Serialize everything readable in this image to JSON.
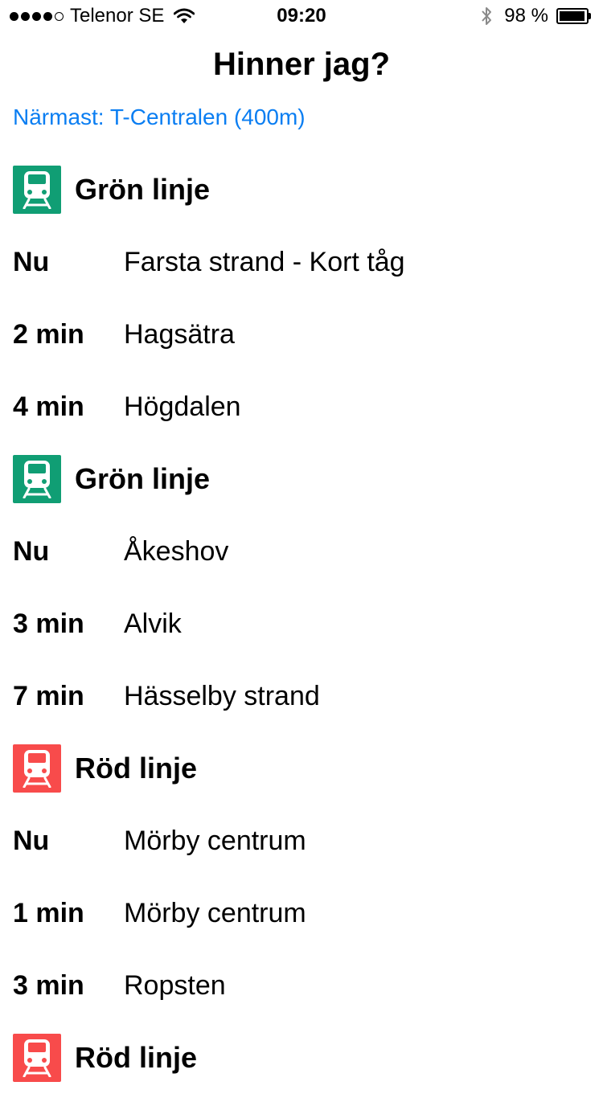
{
  "status_bar": {
    "signal": [
      true,
      true,
      true,
      true,
      false
    ],
    "carrier": "Telenor SE",
    "time": "09:20",
    "battery": "98 %",
    "battery_level": 0.98
  },
  "title": "Hinner jag?",
  "nearest": {
    "label": "Närmast:",
    "station": "T-Centralen",
    "distance": "(400m)"
  },
  "colors": {
    "green_line": "#109e74",
    "red_line": "#f84b4b",
    "link": "#0b7ef2"
  },
  "icon_names": {
    "line": "metro-train-icon"
  },
  "groups": [
    {
      "line": "Grön linje",
      "color": "green",
      "departures": [
        {
          "time": "Nu",
          "destination": "Farsta strand - Kort tåg"
        },
        {
          "time": "2 min",
          "destination": "Hagsätra"
        },
        {
          "time": "4 min",
          "destination": "Högdalen"
        }
      ]
    },
    {
      "line": "Grön linje",
      "color": "green",
      "departures": [
        {
          "time": "Nu",
          "destination": "Åkeshov"
        },
        {
          "time": "3 min",
          "destination": "Alvik"
        },
        {
          "time": "7 min",
          "destination": "Hässelby strand"
        }
      ]
    },
    {
      "line": "Röd linje",
      "color": "red",
      "departures": [
        {
          "time": "Nu",
          "destination": "Mörby centrum"
        },
        {
          "time": "1 min",
          "destination": "Mörby centrum"
        },
        {
          "time": "3 min",
          "destination": "Ropsten"
        }
      ]
    },
    {
      "line": "Röd linje",
      "color": "red",
      "departures": []
    }
  ]
}
